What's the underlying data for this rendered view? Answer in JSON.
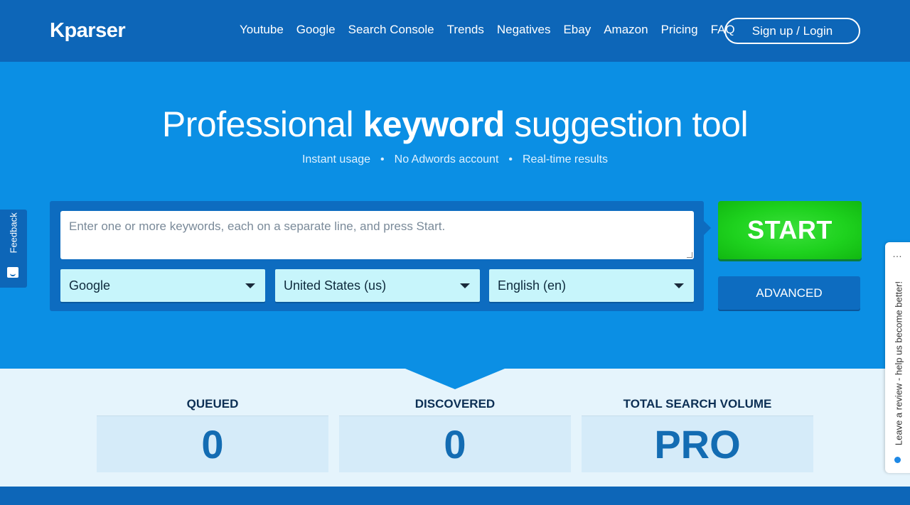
{
  "header": {
    "logo": "Kparser",
    "nav": [
      "Youtube",
      "Google",
      "Search Console",
      "Trends",
      "Negatives",
      "Ebay",
      "Amazon",
      "Pricing",
      "FAQ"
    ],
    "signup_label": "Sign up / Login"
  },
  "hero": {
    "title_pre": "Professional ",
    "title_bold": "keyword",
    "title_post": " suggestion tool",
    "features": [
      "Instant usage",
      "No Adwords account",
      "Real-time results"
    ],
    "separator": "•"
  },
  "form": {
    "placeholder": "Enter one or more keywords, each on a separate line, and press Start.",
    "source_value": "Google",
    "country_value": "United States (us)",
    "language_value": "English (en)",
    "start_label": "START",
    "advanced_label": "ADVANCED"
  },
  "stats": {
    "queued_label": "QUEUED",
    "queued_value": "0",
    "discovered_label": "DISCOVERED",
    "discovered_value": "0",
    "volume_label": "TOTAL SEARCH VOLUME",
    "volume_value": "PRO"
  },
  "feedback_label": "Feedback",
  "review_label": "Leave a review - help us become better!",
  "review_menu": "…",
  "icons": {
    "feedback": "smile-icon",
    "dropdown": "chevron-down-icon",
    "review_status": "dot-icon"
  },
  "colors": {
    "header": "#0d66b8",
    "hero": "#0b8fe4",
    "start": "#1ed21e",
    "select_bg": "#c7f5fb",
    "stats_bg": "#e5f4fc",
    "stat_value": "#136cb3"
  }
}
